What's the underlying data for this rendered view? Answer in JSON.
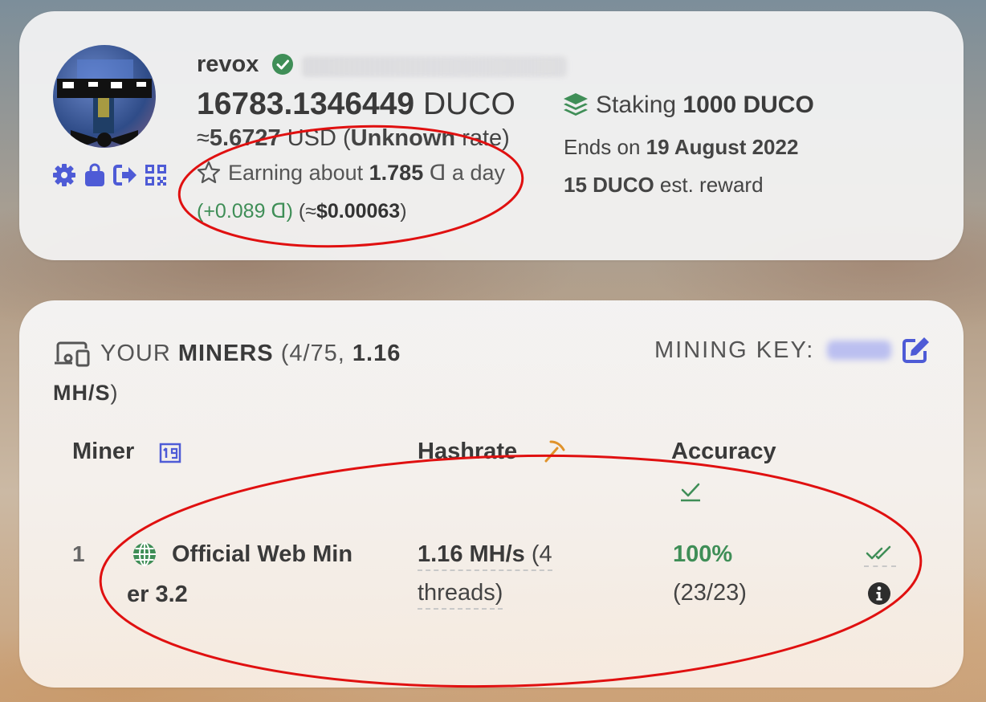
{
  "profile": {
    "username": "revox",
    "balance_value": "16783.1346449",
    "balance_unit": "DUCO",
    "usd_prefix": "≈",
    "usd_value": "5.6727",
    "usd_unit": "USD (",
    "usd_rate": "Unknown",
    "usd_rate_suffix": " rate)",
    "earning_prefix": "Earning about ",
    "earning_value": "1.785",
    "earning_suffix": " ᗡ a day",
    "earning_change": "(+0.089 ᗡ)",
    "earning_usd_prefix": " (≈",
    "earning_usd_value": "$0.00063",
    "earning_usd_suffix": ")"
  },
  "staking": {
    "label": "Staking ",
    "amount": "1000 DUCO",
    "ends_label": "Ends on ",
    "ends_date": "19 August 2022",
    "reward_amount": "15 DUCO",
    "reward_label": " est. reward"
  },
  "miners": {
    "title_prefix": "YOUR ",
    "title_bold": "MINERS",
    "title_count": " (4/75, ",
    "title_hashrate_a": "1.16",
    "title_hashrate_b": "MH/S",
    "title_close": ")",
    "mining_key_label": "MINING KEY:",
    "columns": {
      "miner": "Miner",
      "hashrate": "Hashrate",
      "accuracy": "Accuracy"
    },
    "rows": [
      {
        "index": "1",
        "name_line1": "Official Web Min",
        "name_line2": "er 3.2",
        "hashrate_value": "1.16 MH/s",
        "hashrate_threads_a": " (4",
        "hashrate_threads_b": "threads)",
        "accuracy_percent": "100%",
        "accuracy_shares": "(23/23)"
      }
    ]
  },
  "icons": {
    "avatar_actions": [
      "gear-icon",
      "shopping-bag-icon",
      "logout-icon",
      "qr-code-icon"
    ],
    "verified": "check-circle-icon",
    "earning": "star-outline-icon",
    "staking": "layers-icon",
    "miners": "devices-icon",
    "edit_key": "edit-icon",
    "miner_sort": "sort-numeric-icon",
    "hashrate": "pickaxe-icon",
    "accuracy": "check-icon",
    "web_miner": "globe-icon",
    "status": "double-check-icon",
    "details": "info-circle-icon"
  },
  "colors": {
    "accent_blue": "#4e5bd6",
    "green": "#3f8e57",
    "annotation_red": "#e01010",
    "pickaxe_orange": "#e0922a"
  }
}
